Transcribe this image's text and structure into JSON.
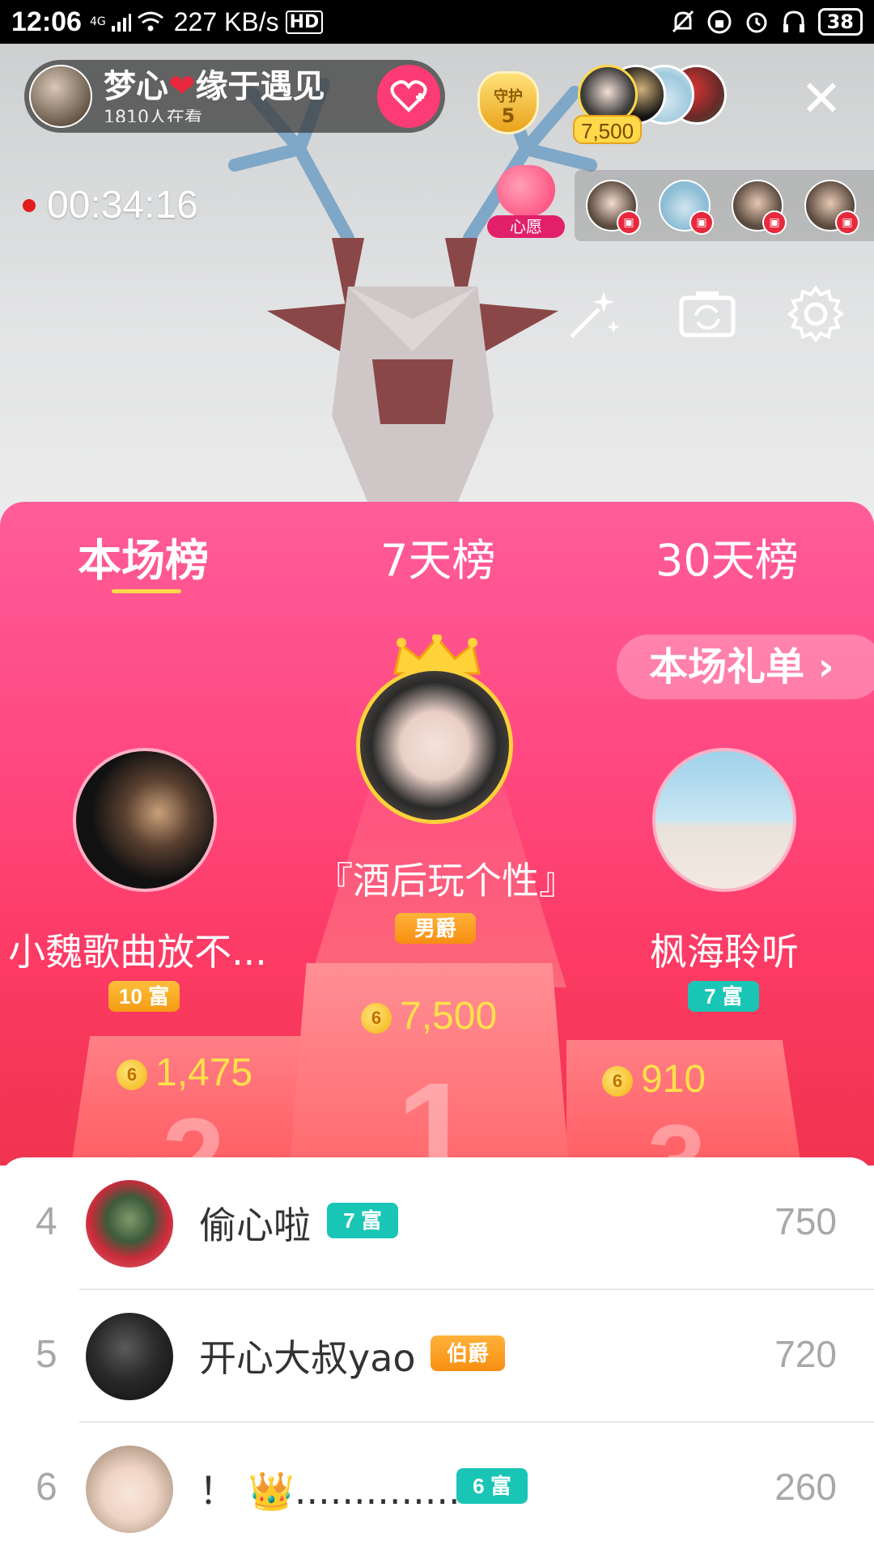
{
  "status_bar": {
    "time": "12:06",
    "network": "4G",
    "speed": "227 KB/s",
    "hd": "HD",
    "battery": "38"
  },
  "live": {
    "host_name_part1": "梦心",
    "host_name_part2": "缘于遇见",
    "viewers": "1810人在看",
    "guard_label": "守护",
    "guard_level": "5",
    "top_contribution": "7,500",
    "timer": "00:34:16",
    "wish_label": "心愿"
  },
  "tabs": [
    "本场榜",
    "7天榜",
    "30天榜"
  ],
  "gift_list_button": "本场礼单 ›",
  "podium": {
    "first": {
      "name": "『酒后玩个性』",
      "badge": "男爵",
      "amount": "7,500"
    },
    "second": {
      "name": "小魏歌曲放不...",
      "badge": "10 富",
      "amount": "1,475"
    },
    "third": {
      "name": "枫海聆听",
      "badge": "7 富",
      "amount": "910"
    },
    "coin_symbol": "6"
  },
  "list": [
    {
      "rank": "4",
      "name": "偷心啦",
      "badge": "7 富",
      "score": "750"
    },
    {
      "rank": "5",
      "name": "开心大叔yao",
      "badge": "伯爵",
      "score": "720"
    },
    {
      "rank": "6",
      "name": "！ 👑..................",
      "badge": "6 富",
      "score": "260"
    }
  ],
  "colors": {
    "panel_top": "#ff5d99",
    "panel_bottom": "#f0344f",
    "gold": "#ffe14a",
    "teal_badge": "#19c6b5",
    "orange_badge": "#f7a51c"
  }
}
